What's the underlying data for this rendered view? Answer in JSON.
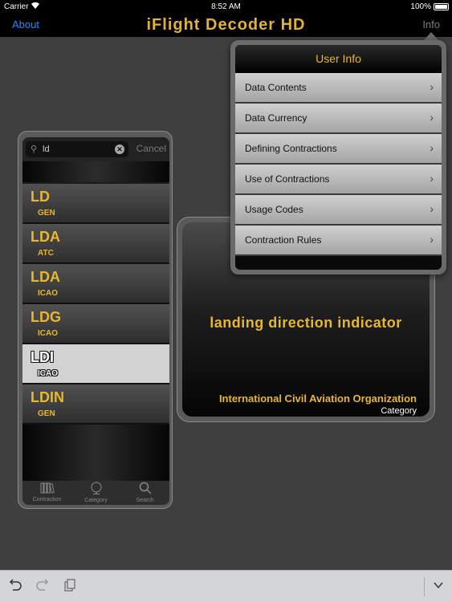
{
  "status_bar": {
    "carrier": "Carrier",
    "time": "8:52 AM",
    "battery_percent": "100%"
  },
  "nav": {
    "left_label": "About",
    "title": "iFlight Decoder HD",
    "right_label": "Info"
  },
  "search": {
    "query": "ld",
    "cancel_label": "Cancel"
  },
  "list": {
    "items": [
      {
        "code": "LD",
        "category": "GEN"
      },
      {
        "code": "LDA",
        "category": "ATC"
      },
      {
        "code": "LDA",
        "category": "ICAO"
      },
      {
        "code": "LDG",
        "category": "ICAO"
      },
      {
        "code": "LDI",
        "category": "ICAO"
      },
      {
        "code": "LDIN",
        "category": "GEN"
      }
    ],
    "selected_index": 4
  },
  "tabs": [
    {
      "label": "Contraction",
      "icon": "books-icon"
    },
    {
      "label": "Category",
      "icon": "globe-icon"
    },
    {
      "label": "Search",
      "icon": "search-icon"
    }
  ],
  "detail": {
    "meaning": "landing direction indicator",
    "organization": "International Civil Aviation Organization",
    "category_label": "Category"
  },
  "popover": {
    "title": "User Info",
    "items": [
      {
        "label": "Data Contents"
      },
      {
        "label": "Data Currency"
      },
      {
        "label": "Defining Contractions"
      },
      {
        "label": "Use of Contractions"
      },
      {
        "label": "Usage Codes"
      },
      {
        "label": "Contraction Rules"
      }
    ]
  },
  "toolbar": {
    "buttons": [
      "undo-icon",
      "redo-icon",
      "clipboard-icon",
      "chevron-down-icon"
    ]
  },
  "colors": {
    "accent_gold": "#e8b72e",
    "link_blue": "#1e8dff",
    "background": "#3f3f3f"
  }
}
